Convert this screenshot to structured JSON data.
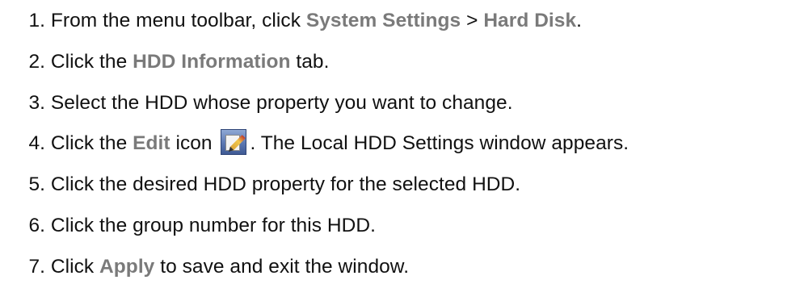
{
  "steps": [
    {
      "number": "1.",
      "t1": "From the menu toolbar, click ",
      "h1": "System Settings",
      "t2": " > ",
      "h2": "Hard Disk",
      "t3": "."
    },
    {
      "number": "2.",
      "t1": "Click the ",
      "h1": "HDD Information",
      "t2": " tab."
    },
    {
      "number": "3.",
      "t1": "Select the HDD whose property you want to change."
    },
    {
      "number": "4.",
      "t1": "Click the ",
      "h1": "Edit",
      "t2": " icon ",
      "icon": "edit-icon",
      "t3": ". The Local HDD Settings window appears."
    },
    {
      "number": "5.",
      "t1": "Click the desired HDD property for the selected HDD."
    },
    {
      "number": "6.",
      "t1": "Click the group number for this HDD."
    },
    {
      "number": "7.",
      "t1": "Click ",
      "h1": "Apply",
      "t2": " to save and exit the window."
    }
  ],
  "colors": {
    "text": "#111111",
    "highlight": "#7a7a7a",
    "background": "#ffffff"
  }
}
